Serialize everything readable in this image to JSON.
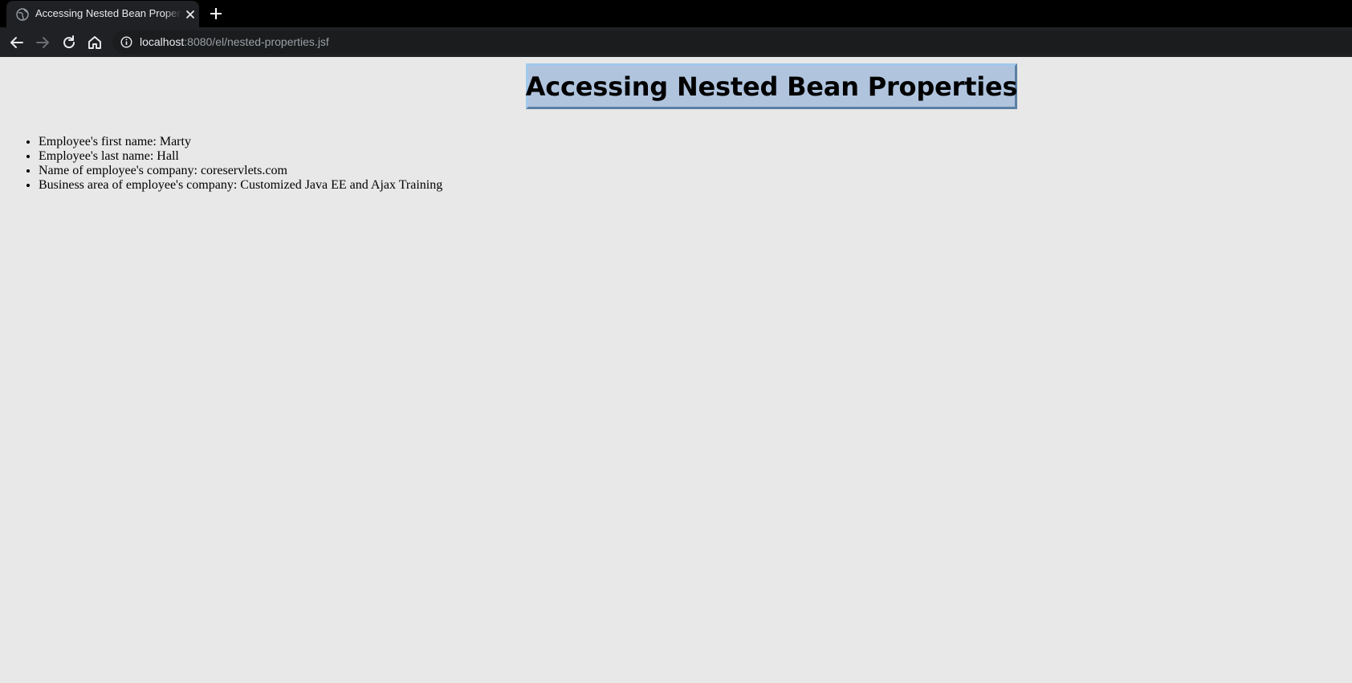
{
  "browser": {
    "tab_title": "Accessing Nested Bean Properties",
    "url_host": "localhost",
    "url_rest": ":8080/el/nested-properties.jsf",
    "icons": {
      "favicon": "globe-icon",
      "close": "close-icon",
      "new_tab": "plus-icon",
      "back": "back-arrow-icon",
      "forward": "forward-arrow-icon",
      "reload": "reload-icon",
      "home": "home-icon",
      "site_info": "info-icon"
    }
  },
  "page": {
    "title": "Accessing Nested Bean Properties",
    "title_bg": "#b0c4de",
    "background": "#e8e8e8",
    "items": [
      {
        "label": "Employee's first name:",
        "value": "Marty"
      },
      {
        "label": "Employee's last name:",
        "value": "Hall"
      },
      {
        "label": "Name of employee's company:",
        "value": "coreservlets.com"
      },
      {
        "label": "Business area of employee's company:",
        "value": "Customized Java EE and Ajax Training"
      }
    ]
  }
}
